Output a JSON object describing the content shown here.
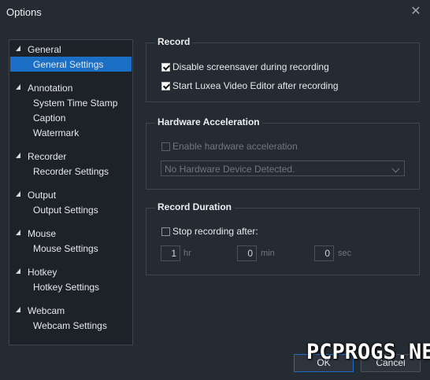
{
  "window": {
    "title": "Options"
  },
  "tree": {
    "groups": [
      {
        "label": "General",
        "children": [
          "General Settings"
        ]
      },
      {
        "label": "Annotation",
        "children": [
          "System Time Stamp",
          "Caption",
          "Watermark"
        ]
      },
      {
        "label": "Recorder",
        "children": [
          "Recorder Settings"
        ]
      },
      {
        "label": "Output",
        "children": [
          "Output Settings"
        ]
      },
      {
        "label": "Mouse",
        "children": [
          "Mouse Settings"
        ]
      },
      {
        "label": "Hotkey",
        "children": [
          "Hotkey Settings"
        ]
      },
      {
        "label": "Webcam",
        "children": [
          "Webcam Settings"
        ]
      }
    ],
    "selected": "General Settings"
  },
  "record": {
    "title": "Record",
    "disable_screensaver": "Disable screensaver during recording",
    "start_editor": "Start Luxea Video Editor after recording"
  },
  "hardware": {
    "title": "Hardware Acceleration",
    "enable_label": "Enable hardware acceleration",
    "device_value": "No Hardware Device Detected."
  },
  "duration": {
    "title": "Record Duration",
    "stop_label": "Stop recording after:",
    "hours": "1",
    "hours_unit": "hr",
    "minutes": "0",
    "minutes_unit": "min",
    "seconds": "0",
    "seconds_unit": "sec"
  },
  "buttons": {
    "ok": "OK",
    "cancel": "Cancel"
  },
  "watermark_text": "PCPROGS.NET",
  "colors": {
    "accent": "#1b6fc4",
    "background": "#252b33",
    "tree_bg": "#1d2228"
  }
}
